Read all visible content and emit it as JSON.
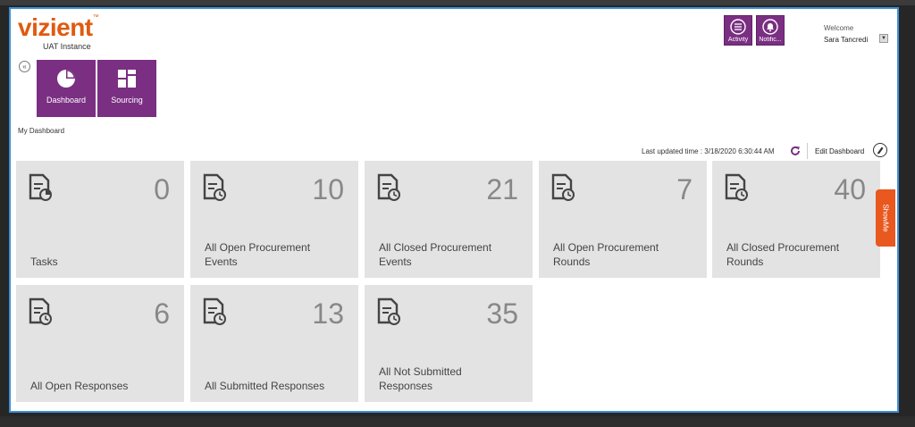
{
  "brand": {
    "logo": "vizient",
    "tm": "™",
    "instance": "UAT Instance"
  },
  "nav": {
    "collapse_glyph": "«",
    "tiles": [
      {
        "label": "Dashboard",
        "icon": "pie-chart-icon"
      },
      {
        "label": "Sourcing",
        "icon": "grid-icon"
      }
    ]
  },
  "breadcrumb": "My Dashboard",
  "header": {
    "activity_label": "Activity",
    "notifications_label": "Notific...",
    "welcome": "Welcome",
    "user": "Sara Tancredi",
    "dropdown_glyph": "▼"
  },
  "toolbar": {
    "last_updated": "Last updated time : 3/18/2020 6:30:44 AM",
    "edit_dashboard": "Edit Dashboard"
  },
  "tiles": [
    {
      "count": "0",
      "label": "Tasks"
    },
    {
      "count": "10",
      "label": "All Open Procurement Events"
    },
    {
      "count": "21",
      "label": "All Closed Procurement Events"
    },
    {
      "count": "7",
      "label": "All Open Procurement Rounds"
    },
    {
      "count": "40",
      "label": "All Closed Procurement Rounds"
    },
    {
      "count": "6",
      "label": "All Open Responses"
    },
    {
      "count": "13",
      "label": "All Submitted Responses"
    },
    {
      "count": "35",
      "label": "All Not Submitted Responses"
    }
  ],
  "showme": "ShowMe",
  "colors": {
    "brand_orange": "#e05a10",
    "nav_purple": "#7a2f82",
    "tile_bg": "#e3e3e3",
    "showme_orange": "#e8581f"
  }
}
